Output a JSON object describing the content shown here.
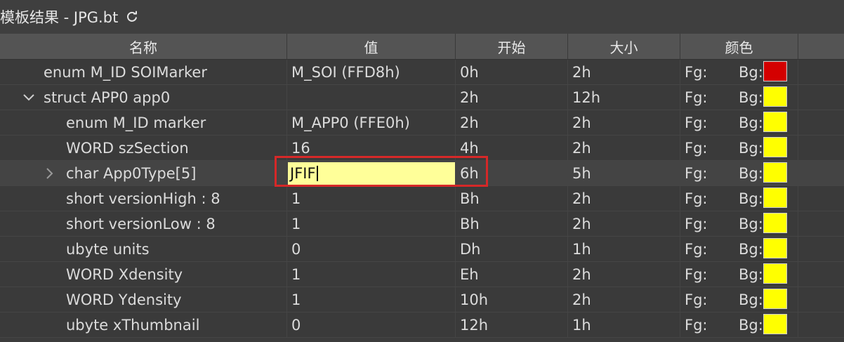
{
  "title": "模板结果 - JPG.bt",
  "icons": {
    "refresh": "refresh-icon",
    "expand": "chevron-down-icon",
    "collapsed": "chevron-right-icon"
  },
  "columns": [
    "名称",
    "值",
    "开始",
    "大小",
    "颜色"
  ],
  "color_labels": {
    "fg": "Fg:",
    "bg": "Bg:"
  },
  "rows": [
    {
      "name": "enum M_ID SOIMarker",
      "value": "M_SOI (FFD8h)",
      "start": "0h",
      "size": "2h",
      "bg_color": "#d40000",
      "indent": 0,
      "arrow": ""
    },
    {
      "name": "struct APP0 app0",
      "value": "",
      "start": "2h",
      "size": "12h",
      "bg_color": "#ffff00",
      "indent": 0,
      "arrow": "expanded"
    },
    {
      "name": "enum M_ID marker",
      "value": "M_APP0 (FFE0h)",
      "start": "2h",
      "size": "2h",
      "bg_color": "#ffff00",
      "indent": 1,
      "arrow": ""
    },
    {
      "name": "WORD szSection",
      "value": "16",
      "start": "4h",
      "size": "2h",
      "bg_color": "#ffff00",
      "indent": 1,
      "arrow": ""
    },
    {
      "name": "char App0Type[5]",
      "value": "JFIF",
      "start": "6h",
      "size": "5h",
      "bg_color": "#ffff00",
      "indent": 1,
      "arrow": "collapsed",
      "editing": true
    },
    {
      "name": "short versionHigh : 8",
      "value": "1",
      "start": "Bh",
      "size": "2h",
      "bg_color": "#ffff00",
      "indent": 1,
      "arrow": ""
    },
    {
      "name": "short versionLow : 8",
      "value": "1",
      "start": "Bh",
      "size": "2h",
      "bg_color": "#ffff00",
      "indent": 1,
      "arrow": ""
    },
    {
      "name": "ubyte units",
      "value": "0",
      "start": "Dh",
      "size": "1h",
      "bg_color": "#ffff00",
      "indent": 1,
      "arrow": ""
    },
    {
      "name": "WORD Xdensity",
      "value": "1",
      "start": "Eh",
      "size": "2h",
      "bg_color": "#ffff00",
      "indent": 1,
      "arrow": ""
    },
    {
      "name": "WORD Ydensity",
      "value": "1",
      "start": "10h",
      "size": "2h",
      "bg_color": "#ffff00",
      "indent": 1,
      "arrow": ""
    },
    {
      "name": "ubyte xThumbnail",
      "value": "0",
      "start": "12h",
      "size": "1h",
      "bg_color": "#ffff00",
      "indent": 1,
      "arrow": ""
    }
  ]
}
